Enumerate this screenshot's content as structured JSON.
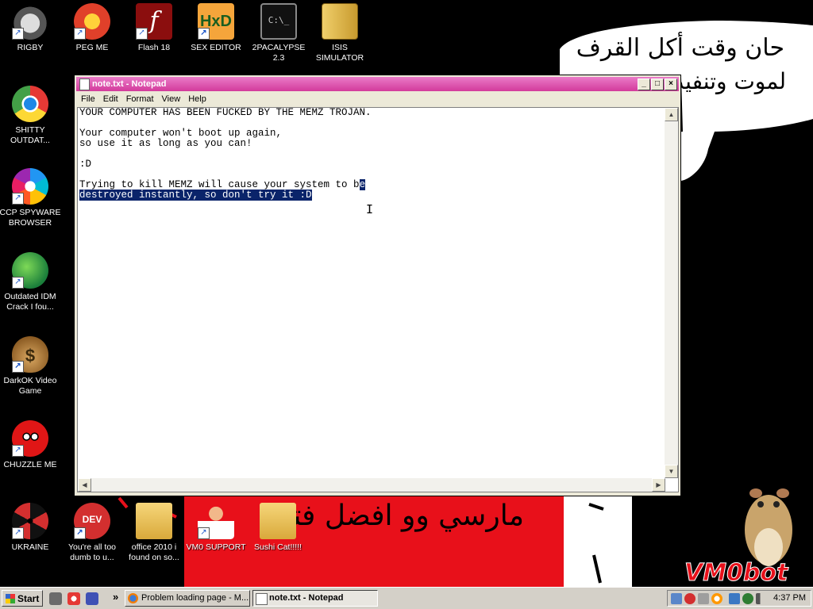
{
  "desktop": {
    "icons": [
      {
        "label": "RIGBY",
        "icon": "raccoon-icon"
      },
      {
        "label": "PEG ME",
        "icon": "peg-p-icon"
      },
      {
        "label": "Flash 18",
        "icon": "flash-icon"
      },
      {
        "label": "SEX EDITOR",
        "icon": "hxd-icon"
      },
      {
        "label": "2PACALYPSE 2.3",
        "icon": "terminal-icon"
      },
      {
        "label": "ISIS SIMULATOR",
        "icon": "winrar-icon"
      },
      {
        "label": "SHITTY OUTDAT...",
        "icon": "chrome-icon"
      },
      {
        "label": "CCP SPYWARE BROWSER",
        "icon": "pinwheel-icon"
      },
      {
        "label": "Outdated IDM Crack I fou...",
        "icon": "idm-globe-icon"
      },
      {
        "label": "DarkOK Video Game",
        "icon": "money-bag-icon"
      },
      {
        "label": "CHUZZLE ME",
        "icon": "chuzzle-icon"
      },
      {
        "label": "UKRAINE",
        "icon": "radiation-icon"
      },
      {
        "label": "You're all too dumb to u...",
        "icon": "devcpp-icon"
      },
      {
        "label": "office 2010 i found on so...",
        "icon": "folder-icon"
      },
      {
        "label": "VM0 SUPPORT",
        "icon": "support-person-icon"
      },
      {
        "label": "Sushi Cat!!!!!",
        "icon": "folder-icon"
      }
    ],
    "wallpaper": {
      "arabic_top_line1": "حان وقت أكل القرف",
      "arabic_top_line2": "لموت وتنفيذ",
      "arabic_banner": "مارسي وو افضل فتاه",
      "watermark": "VM0bot"
    }
  },
  "notepad": {
    "title": "note.txt - Notepad",
    "menu": [
      "File",
      "Edit",
      "Format",
      "View",
      "Help"
    ],
    "lines": [
      "YOUR COMPUTER HAS BEEN FUCKED BY THE MEMZ TROJAN.",
      "",
      "Your computer won't boot up again,",
      "so use it as long as you can!",
      "",
      ":D",
      "",
      "Trying to kill MEMZ will cause your system to b",
      "e",
      "destroyed instantly, so don't try it :D"
    ]
  },
  "taskbar": {
    "start_label": "Start",
    "tasks": [
      {
        "label": "Problem loading page - M...",
        "active": false
      },
      {
        "label": "note.txt - Notepad",
        "active": true
      }
    ],
    "clock": "4:37 PM",
    "overflow": "»"
  },
  "colors": {
    "title_bar": "#d33a9b",
    "selection": "#0a246a",
    "banner_red": "#e8101a"
  }
}
